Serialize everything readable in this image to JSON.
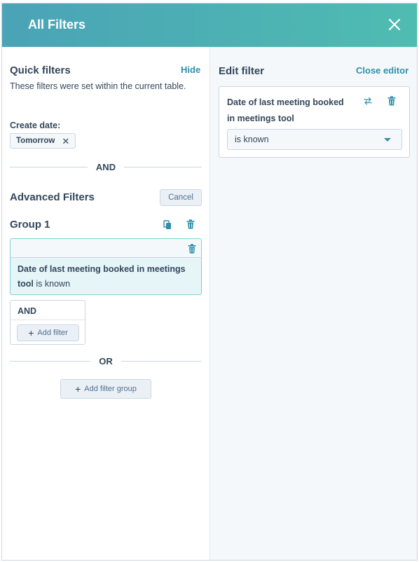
{
  "header": {
    "title": "All Filters"
  },
  "quick_filters": {
    "title": "Quick filters",
    "hide_label": "Hide",
    "description": "These filters were set within the current table.",
    "create_date_label": "Create date:",
    "chip_label": "Tomorrow",
    "chip_remove": "✕"
  },
  "and_divider": "AND",
  "advanced": {
    "title": "Advanced Filters",
    "cancel_label": "Cancel",
    "group_title": "Group 1",
    "filter_bold": "Date of last meeting booked in meetings tool",
    "filter_rest": " is known",
    "and_label": "AND",
    "add_filter_label": "Add filter",
    "or_divider": "OR",
    "add_group_label": "Add filter group"
  },
  "editor": {
    "title": "Edit filter",
    "close_label": "Close editor",
    "property_name": "Date of last meeting booked in meetings tool",
    "operator_value": "is known"
  },
  "colors": {
    "header_start": "#4aa3b6",
    "header_end": "#4fbcb1",
    "accent": "#2f8fa9",
    "text": "#33475b"
  }
}
